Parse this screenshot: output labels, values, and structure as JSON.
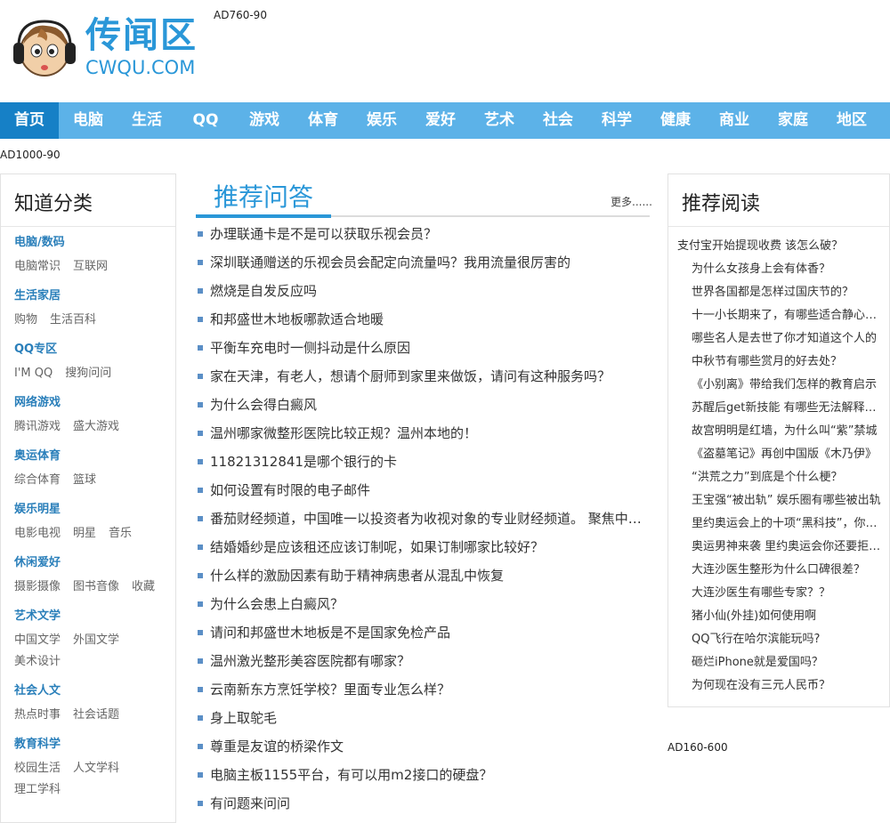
{
  "site": {
    "name_cn": "传闻区",
    "name_en": "CWQU.COM"
  },
  "ads": {
    "top": "AD760-90",
    "wide": "AD1000-90",
    "right": "AD160-600"
  },
  "nav": [
    "首页",
    "电脑",
    "生活",
    "QQ",
    "游戏",
    "体育",
    "娱乐",
    "爱好",
    "艺术",
    "社会",
    "科学",
    "健康",
    "商业",
    "家庭",
    "地区"
  ],
  "left": {
    "title": "知道分类",
    "groups": [
      {
        "head": "电脑/数码",
        "links": [
          "电脑常识",
          "互联网"
        ]
      },
      {
        "head": "生活家居",
        "links": [
          "购物",
          "生活百科"
        ]
      },
      {
        "head": "QQ专区",
        "links": [
          "I'M QQ",
          "搜狗问问"
        ]
      },
      {
        "head": "网络游戏",
        "links": [
          "腾讯游戏",
          "盛大游戏"
        ]
      },
      {
        "head": "奥运体育",
        "links": [
          "综合体育",
          "篮球"
        ]
      },
      {
        "head": "娱乐明星",
        "links": [
          "电影电视",
          "明星",
          "音乐"
        ]
      },
      {
        "head": "休闲爱好",
        "links": [
          "摄影摄像",
          "图书音像",
          "收藏"
        ]
      },
      {
        "head": "艺术文学",
        "links": [
          "中国文学",
          "外国文学",
          "美术设计"
        ]
      },
      {
        "head": "社会人文",
        "links": [
          "热点时事",
          "社会话题"
        ]
      },
      {
        "head": "教育科学",
        "links": [
          "校园生活",
          "人文学科",
          "理工学科"
        ]
      }
    ]
  },
  "center": {
    "title": "推荐问答",
    "more": "更多......",
    "items": [
      "办理联通卡是不是可以获取乐视会员？",
      "深圳联通赠送的乐视会员会配定向流量吗？我用流量很厉害的",
      "燃烧是自发反应吗",
      "和邦盛世木地板哪款适合地暖",
      "平衡车充电时一侧抖动是什么原因",
      "家在天津，有老人，想请个厨师到家里来做饭，请问有这种服务吗？",
      "为什么会得白癜风",
      "温州哪家微整形医院比较正规？温州本地的！",
      "11821312841是哪个银行的卡",
      "如何设置有时限的电子邮件",
      "番茄财经频道，中国唯一以投资者为收视对象的专业财经频道。 聚焦中国资本市场",
      "结婚婚纱是应该租还应该订制呢，如果订制哪家比较好？",
      "什么样的激励因素有助于精神病患者从混乱中恢复",
      "为什么会患上白癜风？",
      "请问和邦盛世木地板是不是国家免检产品",
      "温州激光整形美容医院都有哪家？",
      "云南新东方烹饪学校？里面专业怎么样？",
      "身上取鸵毛",
      "尊重是友谊的桥梁作文",
      "电脑主板1155平台，有可以用m2接口的硬盘？",
      "有问题来问问"
    ]
  },
  "right": {
    "title": "推荐阅读",
    "items": [
      "支付宝开始提现收费 该怎么破？",
      "为什么女孩身上会有体香？",
      "世界各国都是怎样过国庆节的？",
      "十一小长期来了，有哪些适合静心的书",
      "哪些名人是去世了你才知道这个人的",
      "中秋节有哪些赏月的好去处？",
      "《小别离》带给我们怎样的教育启示",
      "苏醒后get新技能 有哪些无法解释的现象",
      "故宫明明是红墙，为什么叫“紫”禁城",
      "《盗墓笔记》再创中国版《木乃伊》",
      "“洪荒之力”到底是个什么梗？",
      "王宝强“被出轨” 娱乐圈有哪些被出轨",
      "里约奥运会上的十项“黑科技”，你知道吗",
      "奥运男神来袭 里约奥运会你还要拒绝吗",
      "大连沙医生整形为什么口碑很差？",
      "大连沙医生有哪些专家？？",
      "猪小仙(外挂)如何使用啊",
      "QQ飞行在哈尔滨能玩吗?",
      "砸烂iPhone就是爱国吗？",
      "为何现在没有三元人民币？"
    ]
  },
  "colors": {
    "accent": "#2a97d8",
    "nav_bg": "#5cb2e8",
    "nav_active": "#1680c6"
  }
}
